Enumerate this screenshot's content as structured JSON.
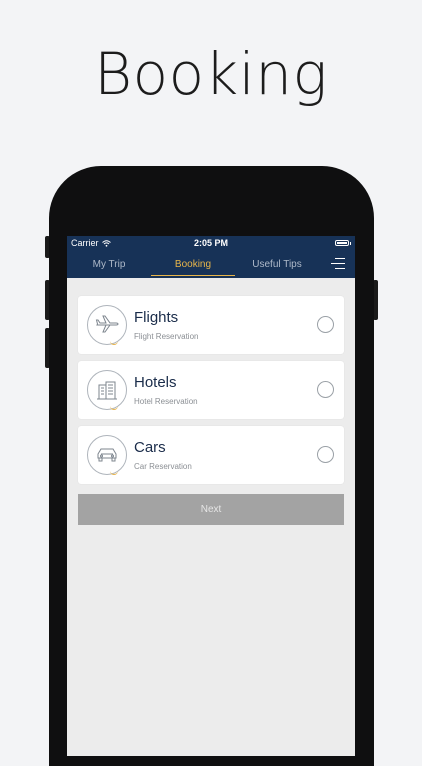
{
  "headline": "Booking",
  "status_bar": {
    "carrier": "Carrier",
    "time": "2:05 PM"
  },
  "tabs": [
    {
      "label": "My Trip",
      "active": false
    },
    {
      "label": "Booking",
      "active": true
    },
    {
      "label": "Useful Tips",
      "active": false
    }
  ],
  "options": [
    {
      "title": "Flights",
      "subtitle": "Flight Reservation",
      "icon": "airplane-icon",
      "selected": false
    },
    {
      "title": "Hotels",
      "subtitle": "Hotel Reservation",
      "icon": "hotel-icon",
      "selected": false
    },
    {
      "title": "Cars",
      "subtitle": "Car Reservation",
      "icon": "car-icon",
      "selected": false
    }
  ],
  "next_label": "Next",
  "colors": {
    "nav": "#173257",
    "accent": "#e8b54a",
    "title": "#1a2c4a",
    "button": "#a3a3a3"
  }
}
